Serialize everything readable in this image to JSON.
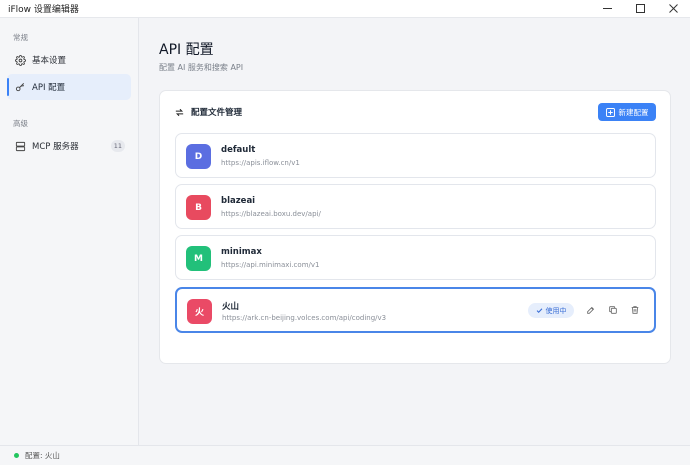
{
  "window": {
    "title": "iFlow 设置编辑器"
  },
  "sidebar": {
    "section_general": "常规",
    "section_advanced": "高级",
    "items": [
      {
        "label": "基本设置",
        "icon": "gear-icon"
      },
      {
        "label": "API 配置",
        "icon": "key-icon"
      },
      {
        "label": "MCP 服务器",
        "icon": "server-icon",
        "badge": "11"
      }
    ]
  },
  "main": {
    "title": "API 配置",
    "subtitle": "配置 AI 服务和搜索 API",
    "card_title": "配置文件管理",
    "new_button": "新建配置",
    "profiles": [
      {
        "initial": "D",
        "name": "default",
        "url": "https://apis.iflow.cn/v1",
        "color": "#5b6ee1"
      },
      {
        "initial": "B",
        "name": "blazeai",
        "url": "https://blazeai.boxu.dev/api/",
        "color": "#e84a5f"
      },
      {
        "initial": "M",
        "name": "minimax",
        "url": "https://api.minimaxi.com/v1",
        "color": "#22c07a"
      },
      {
        "initial": "火",
        "name": "火山",
        "url": "https://ark.cn-beijing.volces.com/api/coding/v3",
        "color": "#ea4a66",
        "active": true,
        "status": "使用中"
      }
    ]
  },
  "statusbar": {
    "text": "配置: 火山",
    "dot_color": "#22c55e"
  }
}
